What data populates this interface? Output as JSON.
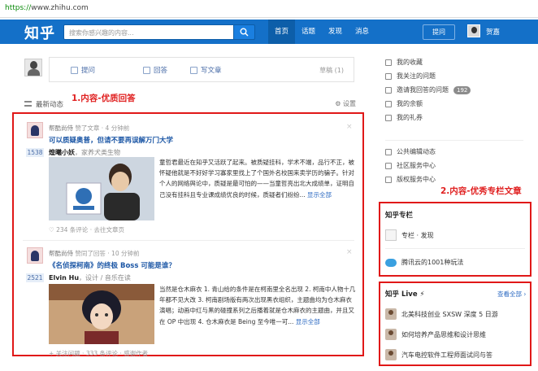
{
  "browser": {
    "url_scheme": "https://",
    "url_host": "www.zhihu.com"
  },
  "header": {
    "logo": "知乎",
    "search_placeholder": "搜索你感兴趣的内容...",
    "nav": [
      "首页",
      "话题",
      "发现",
      "消息"
    ],
    "ask_button": "提问",
    "username": "贺嘉"
  },
  "composer": {
    "ask": "提问",
    "answer": "回答",
    "write": "写文章",
    "drafts": "草稿 (1)"
  },
  "feed": {
    "title": "最新动态",
    "settings": "设置",
    "annotation": "1.内容-优质回答",
    "cards": [
      {
        "source": "帮酷尚侍",
        "action": "赞了文章",
        "time": "4 分钟前",
        "title": "可以质疑奥普，但请不要再误解万门大学",
        "votes": "1538",
        "author": "煌曦小妖",
        "author_desc": "，家养犬类生物",
        "excerpt": "童哲君最近在知乎又活跃了起来。被质疑挂科，学术不端，品行不正，被怀疑他就是不好好学习寡家里找上了个国外名校国来卖学历的骗子。针对个人的网络舆论中，质疑是最可怕的——当童哲亮出北大成绩单，证明自己没有挂科且专业课成绩优良的时候，质疑者们纷纷...",
        "more": "显示全部",
        "footer": "♡ 234 条评论 · 去往文章页"
      },
      {
        "source": "帮酷尚侍",
        "action": "赞同了回答",
        "time": "10 分钟前",
        "title": "《名侦探柯南》的终极 Boss 可能是谁？",
        "votes": "2521",
        "author": "Elvin Hu",
        "author_desc": "，设计 / 音乐在读",
        "excerpt": "当然是仓木麻衣 1. 青山给的条件是在柯南里全名出现 2. 柯南中人物十几年都不见大改 3. 柯南剧场版有两次出现黑衣组织，主题曲均为仓木麻衣演唱；动画中红与黑的碰撞系列之后播着就是仓木麻衣的主题曲，并且又在 OP 中出现 4. 仓木麻衣是 Being 至今唯一可...",
        "more": "显示全部",
        "footer": "+ 关注问题 · 333 条评论 · 感谢作者"
      }
    ]
  },
  "sidebar": {
    "items": [
      "我的收藏",
      "我关注的问题",
      "邀请我回答的问题",
      "我的余额",
      "我的礼券"
    ],
    "invite_badge": "192",
    "items2": [
      "公共编辑动态",
      "社区服务中心",
      "版权服务中心"
    ],
    "annotation": "2.内容-优秀专栏文章",
    "column_title": "知乎专栏",
    "column_items": [
      "专栏 · 发现",
      "腾讯云的1001种玩法"
    ],
    "live_title": "知乎 Live ⚡",
    "live_see_all": "查看全部 ›",
    "live_items": [
      "北美科技创业 SXSW 深度 5 日游",
      "如何培养产品思维和设计思维",
      "汽车电控软件工程师面试问与答"
    ]
  },
  "colors": {
    "brand": "#1470c8",
    "annotation_red": "#e01818",
    "link": "#1b56a5"
  }
}
